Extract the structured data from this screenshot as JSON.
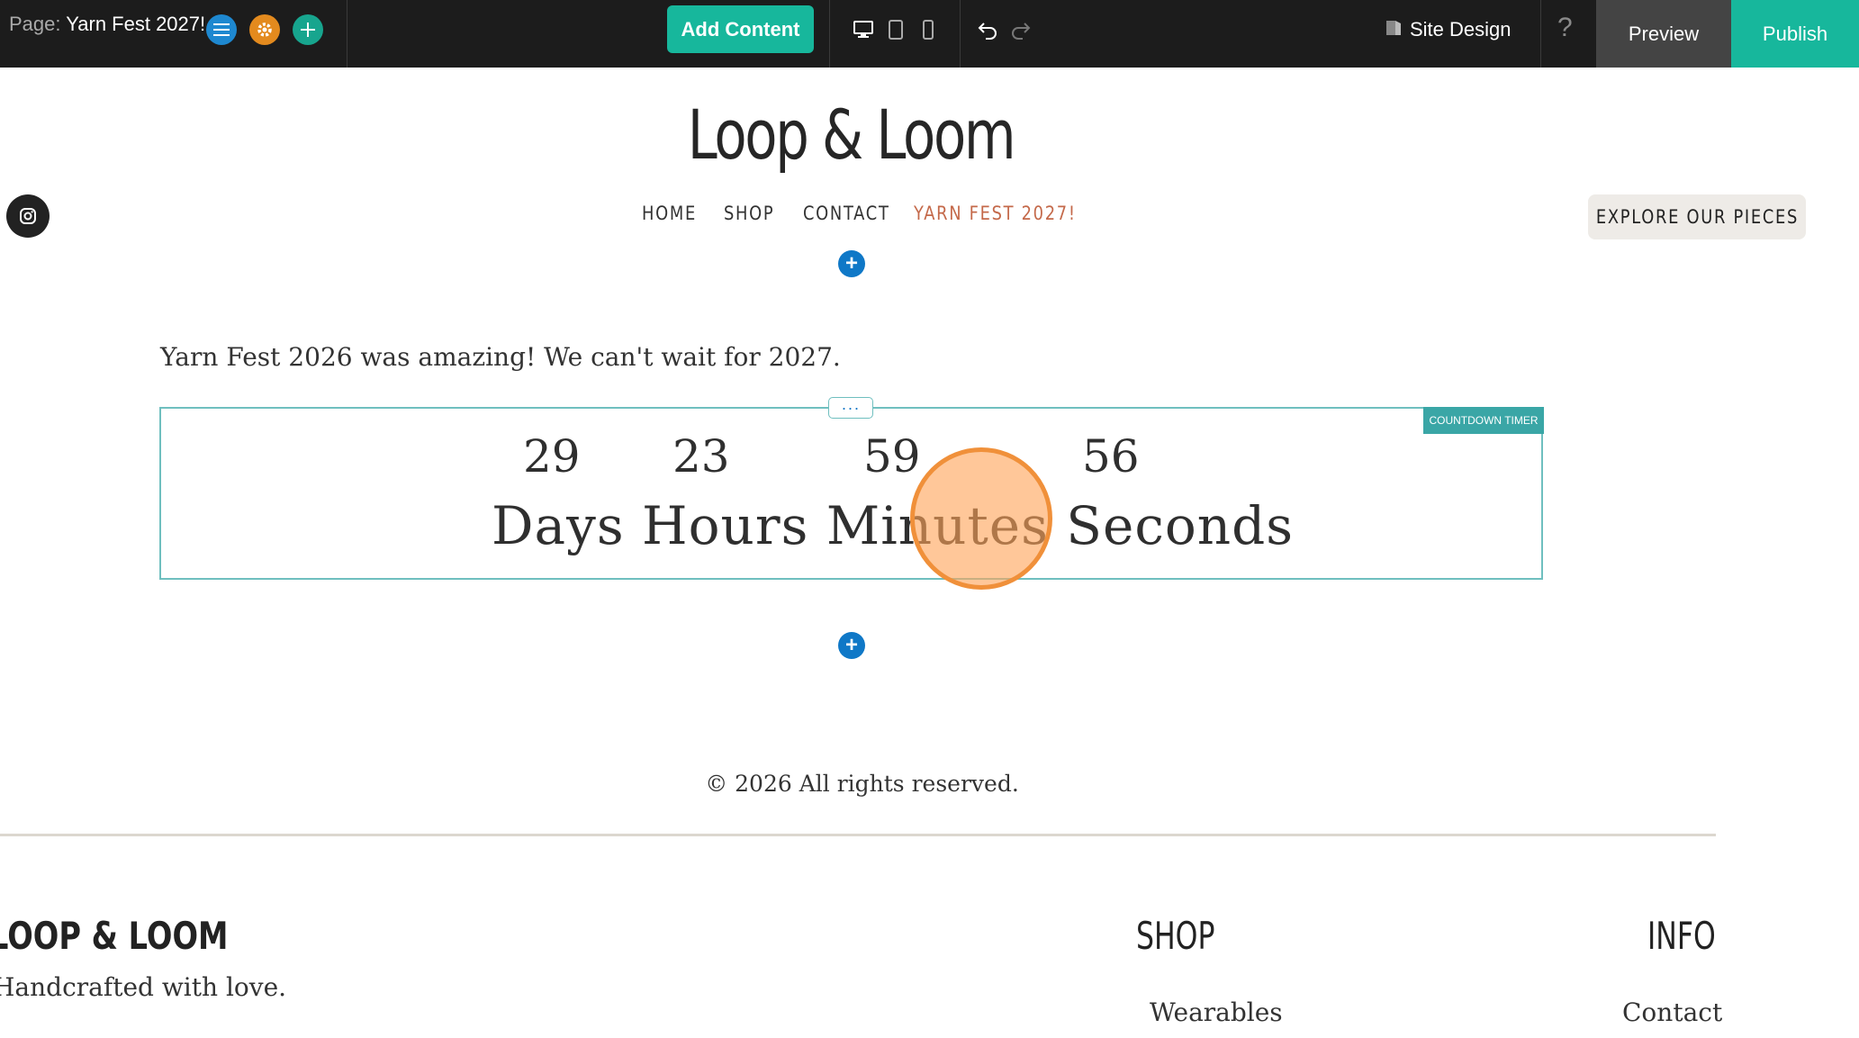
{
  "toolbar": {
    "page_label": "Page:",
    "page_name": "Yarn Fest 2027!",
    "add_content": "Add Content",
    "site_design": "Site Design",
    "help": "?",
    "preview": "Preview",
    "publish": "Publish",
    "colors": {
      "bar": "#1c1c1c",
      "accent": "#17b79c",
      "blue": "#1e88d0",
      "orange": "#e38a1e"
    }
  },
  "site": {
    "title": "Loop & Loom",
    "nav": [
      "HOME",
      "SHOP",
      "CONTACT",
      "YARN FEST 2027!"
    ],
    "explore_button": "EXPLORE OUR PIECES",
    "active_nav_color": "#c4694a"
  },
  "content": {
    "intro": "Yarn Fest 2026 was amazing! We can't wait for 2027.",
    "countdown": {
      "tag": "COUNTDOWN TIMER",
      "menu": "···",
      "days": "29",
      "hours": "23",
      "minutes": "59",
      "seconds": "56",
      "labels": "Days Hours Minutes Seconds"
    },
    "copyright": "© 2026 All rights reserved."
  },
  "footer": {
    "brand": "LOOP & LOOM",
    "tagline": "Handcrafted with love.",
    "shop_heading": "SHOP",
    "shop_link": "Wearables",
    "info_heading": "INFO",
    "info_link": "Contact"
  }
}
